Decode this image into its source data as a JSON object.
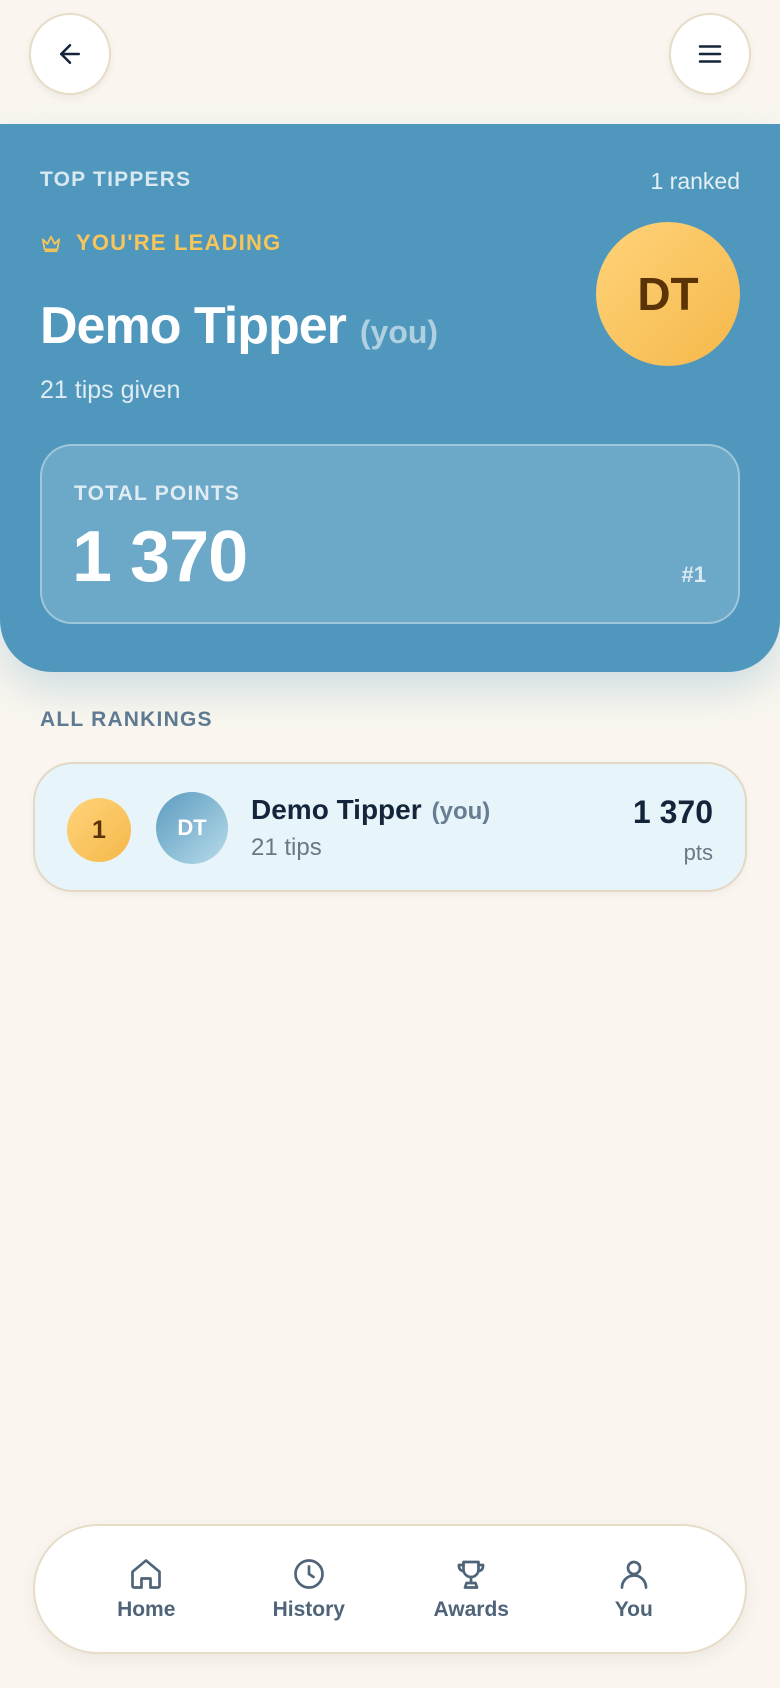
{
  "header": {
    "back_icon": "arrow-left-icon",
    "menu_icon": "hamburger-menu-icon"
  },
  "hero": {
    "section_title": "TOP TIPPERS",
    "ranked_count": "1 ranked",
    "leading_icon": "crown-icon",
    "leading_label": "YOU'RE LEADING",
    "name": "Demo Tipper",
    "you_tag": "(you)",
    "tips_given": "21 tips given",
    "avatar_initials": "DT",
    "points_label": "TOTAL POINTS",
    "points_value": "1 370",
    "rank_label": "#1"
  },
  "rankings": {
    "title": "ALL RANKINGS",
    "rows": [
      {
        "rank": "1",
        "initials": "DT",
        "name": "Demo Tipper",
        "you_tag": "(you)",
        "tips": "21 tips",
        "points": "1 370",
        "points_unit": "pts"
      }
    ]
  },
  "nav": {
    "items": [
      {
        "label": "Home",
        "icon": "home-icon"
      },
      {
        "label": "History",
        "icon": "clock-icon"
      },
      {
        "label": "Awards",
        "icon": "trophy-icon"
      },
      {
        "label": "You",
        "icon": "user-icon"
      }
    ]
  },
  "colors": {
    "background": "#faf6ef",
    "hero": "#4f97bc",
    "gold": "#f7c55a",
    "dark_text": "#14243a"
  }
}
